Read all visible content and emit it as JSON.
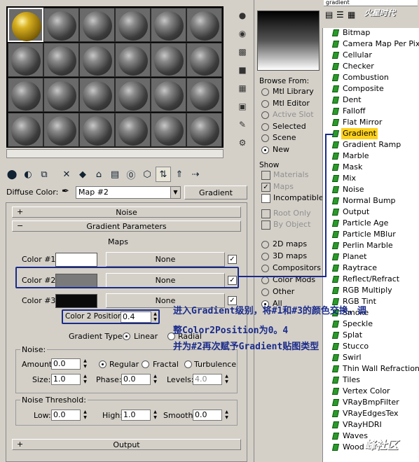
{
  "slots": {
    "rows": 4,
    "cols": 6,
    "active_index": 0
  },
  "diffuse": {
    "label": "Diffuse Color:",
    "map_value": "Map #2",
    "type_button": "Gradient"
  },
  "rollouts": {
    "noise_top": "Noise",
    "gradient_params": "Gradient Parameters",
    "output": "Output"
  },
  "gradient": {
    "maps_header": "Maps",
    "colors": [
      {
        "label": "Color #1",
        "swatch": "#ffffff",
        "map": "None",
        "checked": true
      },
      {
        "label": "Color #2",
        "swatch": "#7a7a7a",
        "map": "None",
        "checked": true
      },
      {
        "label": "Color #3",
        "swatch": "#0a0a0a",
        "map": "None",
        "checked": true
      }
    ],
    "position_label": "Color 2 Position:",
    "position_value": "0.4",
    "type_label": "Gradient Type:",
    "types": [
      "Linear",
      "Radial"
    ],
    "type_selected": "Linear"
  },
  "noise": {
    "group_label": "Noise:",
    "amount_label": "Amount:",
    "amount_value": "0.0",
    "kinds": [
      "Regular",
      "Fractal",
      "Turbulence"
    ],
    "kind_selected": "Regular",
    "size_label": "Size:",
    "size_value": "1.0",
    "phase_label": "Phase:",
    "phase_value": "0.0",
    "levels_label": "Levels:",
    "levels_value": "4.0"
  },
  "threshold": {
    "group_label": "Noise Threshold:",
    "low_label": "Low:",
    "low_value": "0.0",
    "high_label": "High:",
    "high_value": "1.0",
    "smooth_label": "Smooth:",
    "smooth_value": "0.0"
  },
  "browser": {
    "search_value": "gradient",
    "browse_from_label": "Browse From:",
    "browse_from": [
      {
        "label": "Mtl Library",
        "selected": false,
        "disabled": false
      },
      {
        "label": "Mtl Editor",
        "selected": false,
        "disabled": false
      },
      {
        "label": "Active Slot",
        "selected": false,
        "disabled": true
      },
      {
        "label": "Selected",
        "selected": false,
        "disabled": false
      },
      {
        "label": "Scene",
        "selected": false,
        "disabled": false
      },
      {
        "label": "New",
        "selected": true,
        "disabled": false
      }
    ],
    "show_label": "Show",
    "show": [
      {
        "label": "Materials",
        "checked": false,
        "disabled": true
      },
      {
        "label": "Maps",
        "checked": true,
        "disabled": true
      },
      {
        "label": "Incompatible",
        "checked": false,
        "disabled": false
      }
    ],
    "root_only": "Root Only",
    "by_object": "By Object",
    "map_cats": [
      {
        "label": "2D maps",
        "selected": false
      },
      {
        "label": "3D maps",
        "selected": false
      },
      {
        "label": "Compositors",
        "selected": false
      },
      {
        "label": "Color Mods",
        "selected": false
      },
      {
        "label": "Other",
        "selected": false
      },
      {
        "label": "All",
        "selected": true
      }
    ],
    "maps": [
      "Bitmap",
      "Camera Map Per Pixel",
      "Cellular",
      "Checker",
      "Combustion",
      "Composite",
      "Dent",
      "Falloff",
      "Flat Mirror",
      "Gradient",
      "Gradient Ramp",
      "Marble",
      "Mask",
      "Mix",
      "Noise",
      "Normal Bump",
      "Output",
      "Particle Age",
      "Particle MBlur",
      "Perlin Marble",
      "Planet",
      "Raytrace",
      "Reflect/Refract",
      "RGB Multiply",
      "RGB Tint",
      "Smoke",
      "Speckle",
      "Splat",
      "Stucco",
      "Swirl",
      "Thin Wall Refraction",
      "Tiles",
      "Vertex Color",
      "VRayBmpFilter",
      "VRayEdgesTex",
      "VRayHDRI",
      "Waves",
      "Wood"
    ],
    "selected_map": "Gradient"
  },
  "annotation": {
    "line1": "进入Gradient级别，将#1和#3的颜色交换，调",
    "line2": "整Color2Position为0。4",
    "line3": "并为#2再次赋予Gradient贴图类型"
  },
  "watermarks": {
    "top": "火星时代",
    "bottom": "峰社区"
  }
}
